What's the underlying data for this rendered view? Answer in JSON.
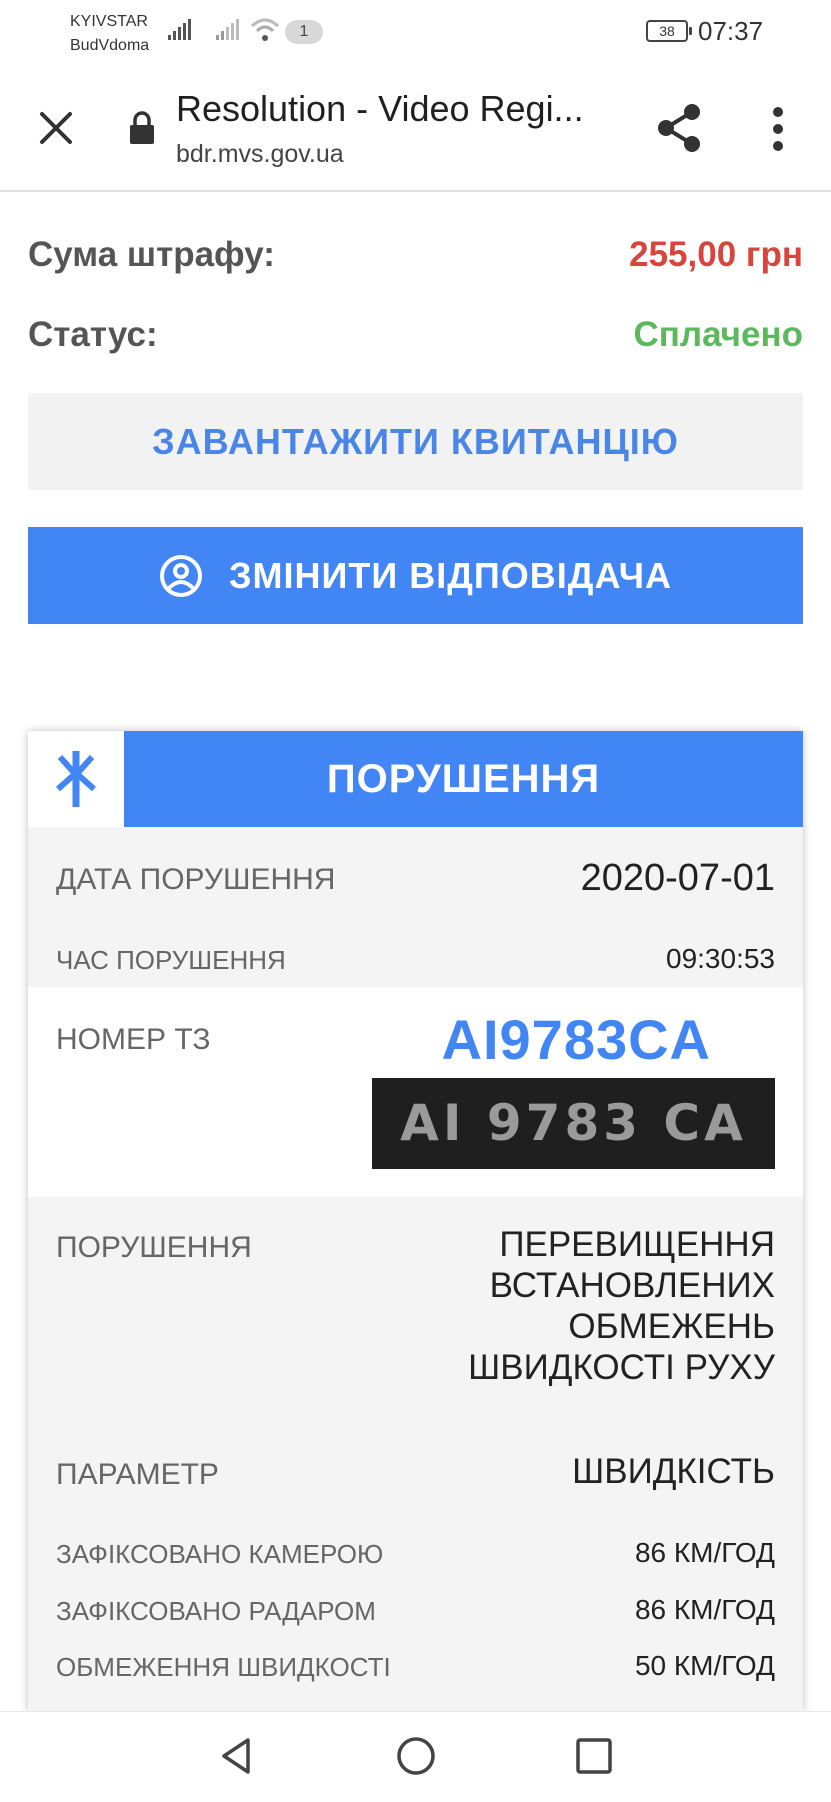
{
  "status_bar": {
    "carrier_line1": "KYIVSTAR",
    "carrier_line2": "BudVdoma",
    "notification_count": "1",
    "battery": "38",
    "time": "07:37"
  },
  "browser": {
    "title": "Resolution - Video Regi...",
    "url": "bdr.mvs.gov.ua"
  },
  "summary": {
    "fine_label": "Сума штрафу:",
    "fine_value": "255,00 грн",
    "status_label": "Статус:",
    "status_value": "Сплачено"
  },
  "buttons": {
    "download_receipt": "ЗАВАНТАЖИТИ КВИТАНЦІЮ",
    "change_responsible": "ЗМІНИТИ ВІДПОВІДАЧА"
  },
  "violation_card": {
    "title": "ПОРУШЕННЯ",
    "date_label": "ДАТА ПОРУШЕННЯ",
    "date_value": "2020-07-01",
    "time_label": "ЧАС ПОРУШЕННЯ",
    "time_value": "09:30:53",
    "plate_label": "НОМЕР ТЗ",
    "plate_value": "AI9783CA",
    "plate_photo_text": "AI 9783 CA",
    "violation_label": "ПОРУШЕННЯ",
    "violation_lines": [
      "ПЕРЕВИЩЕННЯ",
      "ВСТАНОВЛЕНИХ",
      "ОБМЕЖЕНЬ",
      "ШВИДКОСТІ РУХУ"
    ],
    "parameter_label": "ПАРАМЕТР",
    "parameter_value": "ШВИДКІСТЬ",
    "camera_label": "ЗАФІКСОВАНО КАМЕРОЮ",
    "camera_value": "86 КМ/ГОД",
    "radar_label": "ЗАФІКСОВАНО РАДАРОМ",
    "radar_value": "86 КМ/ГОД",
    "limit_label": "ОБМЕЖЕННЯ ШВИДКОСТІ",
    "limit_value": "50 КМ/ГОД"
  },
  "colors": {
    "accent_blue": "#4285f4",
    "fine_red": "#d9443c",
    "paid_green": "#5cb85c"
  },
  "icons": [
    "signal-icon",
    "wifi-icon",
    "battery-icon",
    "close-icon",
    "lock-icon",
    "share-icon",
    "more-vert-icon",
    "account-circle-icon",
    "police-logo-icon",
    "nav-back-icon",
    "nav-home-icon",
    "nav-recent-icon"
  ]
}
